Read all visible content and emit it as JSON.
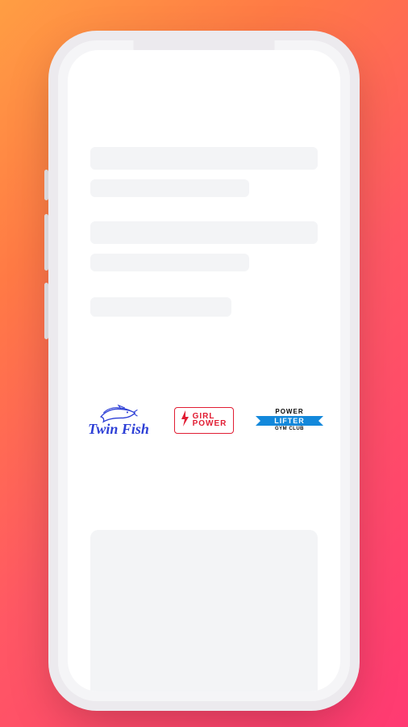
{
  "logos": [
    {
      "name": "twin-fish",
      "line1": "Twin Fish"
    },
    {
      "name": "girl-power",
      "line1": "GIRL",
      "line2": "POWER"
    },
    {
      "name": "power-lifter",
      "line1": "POWER",
      "line2": "LIFTER",
      "line3": "GYM CLUB"
    }
  ]
}
